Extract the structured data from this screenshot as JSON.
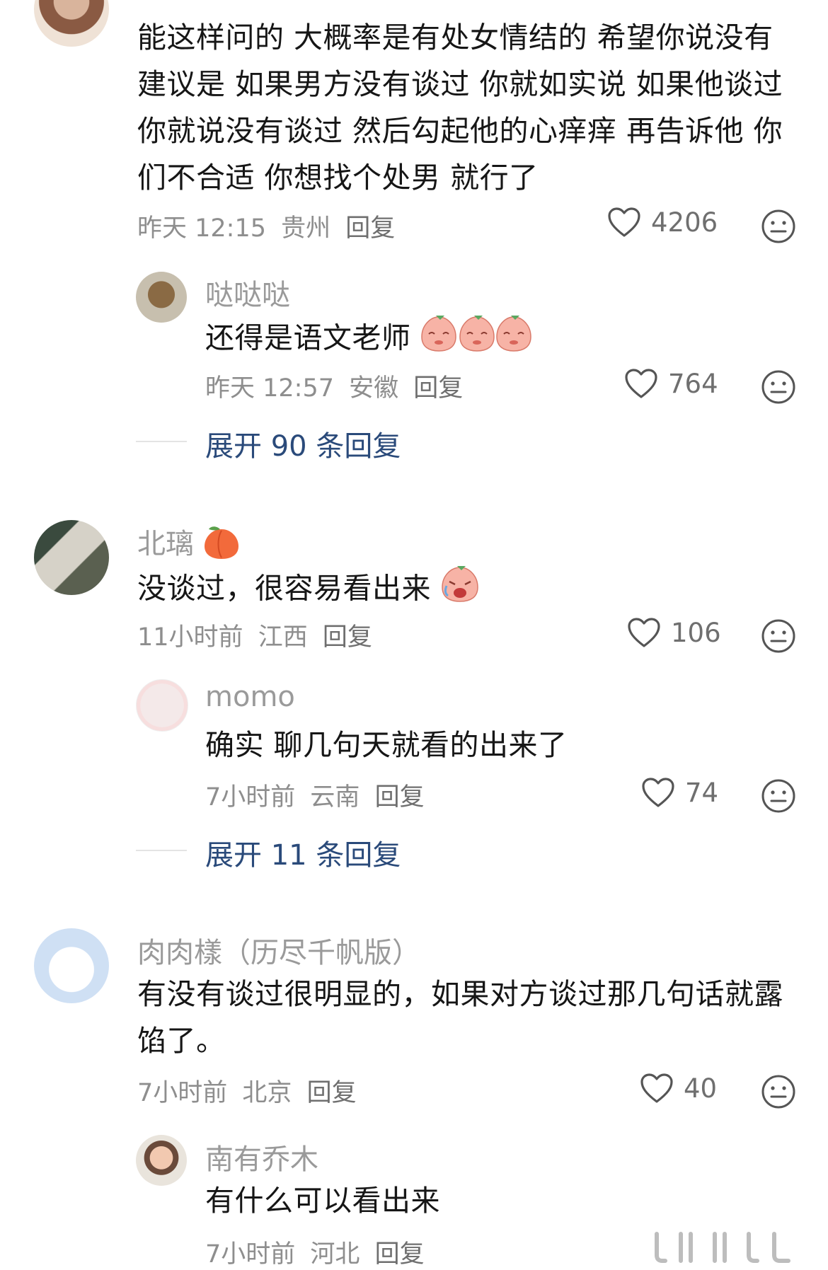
{
  "comments": [
    {
      "name": "",
      "text": "能这样问的 大概率是有处女情结的 希望你说没有 建议是  如果男方没有谈过 你就如实说 如果他谈过 你就说没有谈过 然后勾起他的心痒痒 再告诉他 你们不合适 你想找个处男 就行了",
      "time": "昨天 12:15",
      "region": "贵州",
      "reply": "回复",
      "likes": "4206",
      "replies": [
        {
          "name": "哒哒哒",
          "text": "还得是语文老师",
          "time": "昨天 12:57",
          "region": "安徽",
          "reply": "回复",
          "likes": "764"
        }
      ],
      "expand": "展开 90 条回复"
    },
    {
      "name": "北璃",
      "text": "没谈过，很容易看出来",
      "time": "11小时前",
      "region": "江西",
      "reply": "回复",
      "likes": "106",
      "replies": [
        {
          "name": "momo",
          "text": "确实 聊几句天就看的出来了",
          "time": "7小时前",
          "region": "云南",
          "reply": "回复",
          "likes": "74"
        }
      ],
      "expand": "展开 11 条回复"
    },
    {
      "name": "肉肉樣（历尽千帆版）",
      "text": "有没有谈过很明显的，如果对方谈过那几句话就露馅了。",
      "time": "7小时前",
      "region": "北京",
      "reply": "回复",
      "likes": "40",
      "replies": [
        {
          "name": "南有乔木",
          "text": "有什么可以看出来",
          "time": "7小时前",
          "region": "河北",
          "reply": "回复"
        }
      ]
    }
  ],
  "icons": {
    "like": "heart-outline-icon",
    "react": "neutral-face-icon",
    "sticker": "peach-sticker-icon"
  },
  "colors": {
    "expand_link": "#2a4a7a",
    "meta_gray": "#8e8e8e"
  }
}
